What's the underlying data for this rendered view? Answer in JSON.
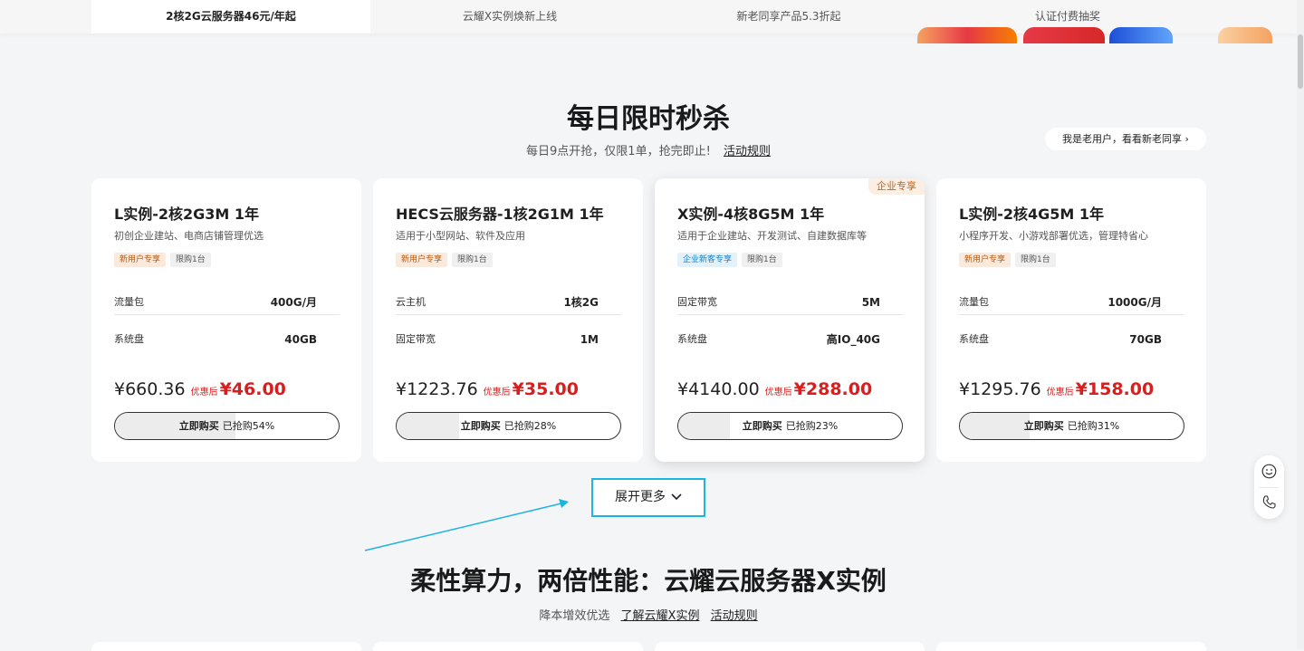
{
  "tabs": [
    {
      "label": "2核2G云服务器46元/年起",
      "active": true
    },
    {
      "label": "云耀X实例焕新上线",
      "active": false
    },
    {
      "label": "新老同享产品5.3折起",
      "active": false
    },
    {
      "label": "认证付费抽奖",
      "active": false
    }
  ],
  "flash_sale": {
    "title": "每日限时秒杀",
    "subtitle": "每日9点开抢，仅限1单，抢完即止!",
    "rules_link": "活动规则",
    "old_user_button": "我是老用户，看看新老同享 ›"
  },
  "products": [
    {
      "title": "L实例-2核2G3M 1年",
      "desc": "初创企业建站、电商店铺管理优选",
      "tags": [
        {
          "text": "新用户专享",
          "style": "orange"
        },
        {
          "text": "限购1台",
          "style": "gray"
        }
      ],
      "specs": [
        {
          "label": "流量包",
          "value": "400G/月"
        },
        {
          "label": "系统盘",
          "value": "40GB"
        }
      ],
      "original_price": "¥660.36",
      "after_label": "优惠后",
      "sale_price": "¥46.00",
      "buy_label": "立即购买",
      "sold_text": "已抢购54%",
      "sold_fraction": 0.54,
      "ribbon": ""
    },
    {
      "title": "HECS云服务器-1核2G1M 1年",
      "desc": "适用于小型网站、软件及应用",
      "tags": [
        {
          "text": "新用户专享",
          "style": "orange"
        },
        {
          "text": "限购1台",
          "style": "gray"
        }
      ],
      "specs": [
        {
          "label": "云主机",
          "value": "1核2G"
        },
        {
          "label": "固定带宽",
          "value": "1M"
        }
      ],
      "original_price": "¥1223.76",
      "after_label": "优惠后",
      "sale_price": "¥35.00",
      "buy_label": "立即购买",
      "sold_text": "已抢购28%",
      "sold_fraction": 0.28,
      "ribbon": ""
    },
    {
      "title": "X实例-4核8G5M 1年",
      "desc": "适用于企业建站、开发测试、自建数据库等",
      "tags": [
        {
          "text": "企业新客专享",
          "style": "blue"
        },
        {
          "text": "限购1台",
          "style": "gray"
        }
      ],
      "specs": [
        {
          "label": "固定带宽",
          "value": "5M"
        },
        {
          "label": "系统盘",
          "value": "高IO_40G"
        }
      ],
      "original_price": "¥4140.00",
      "after_label": "优惠后",
      "sale_price": "¥288.00",
      "buy_label": "立即购买",
      "sold_text": "已抢购23%",
      "sold_fraction": 0.23,
      "ribbon": "企业专享"
    },
    {
      "title": "L实例-2核4G5M 1年",
      "desc": "小程序开发、小游戏部署优选，管理特省心",
      "tags": [
        {
          "text": "新用户专享",
          "style": "orange"
        },
        {
          "text": "限购1台",
          "style": "gray"
        }
      ],
      "specs": [
        {
          "label": "流量包",
          "value": "1000G/月"
        },
        {
          "label": "系统盘",
          "value": "70GB"
        }
      ],
      "original_price": "¥1295.76",
      "after_label": "优惠后",
      "sale_price": "¥158.00",
      "buy_label": "立即购买",
      "sold_text": "已抢购31%",
      "sold_fraction": 0.31,
      "ribbon": ""
    }
  ],
  "expand_button": "展开更多",
  "x_section": {
    "title": "柔性算力，两倍性能：云耀云服务器X实例",
    "subtitle": "降本增效优选",
    "learn_link": "了解云耀X实例",
    "rules_link": "活动规则"
  },
  "colors": {
    "accent_red": "#d91e1e",
    "highlight_blue": "#1fb3e0"
  },
  "icons": {
    "float_1": "smiley-icon",
    "float_2": "phone-icon",
    "expand": "chevron-down-icon"
  }
}
